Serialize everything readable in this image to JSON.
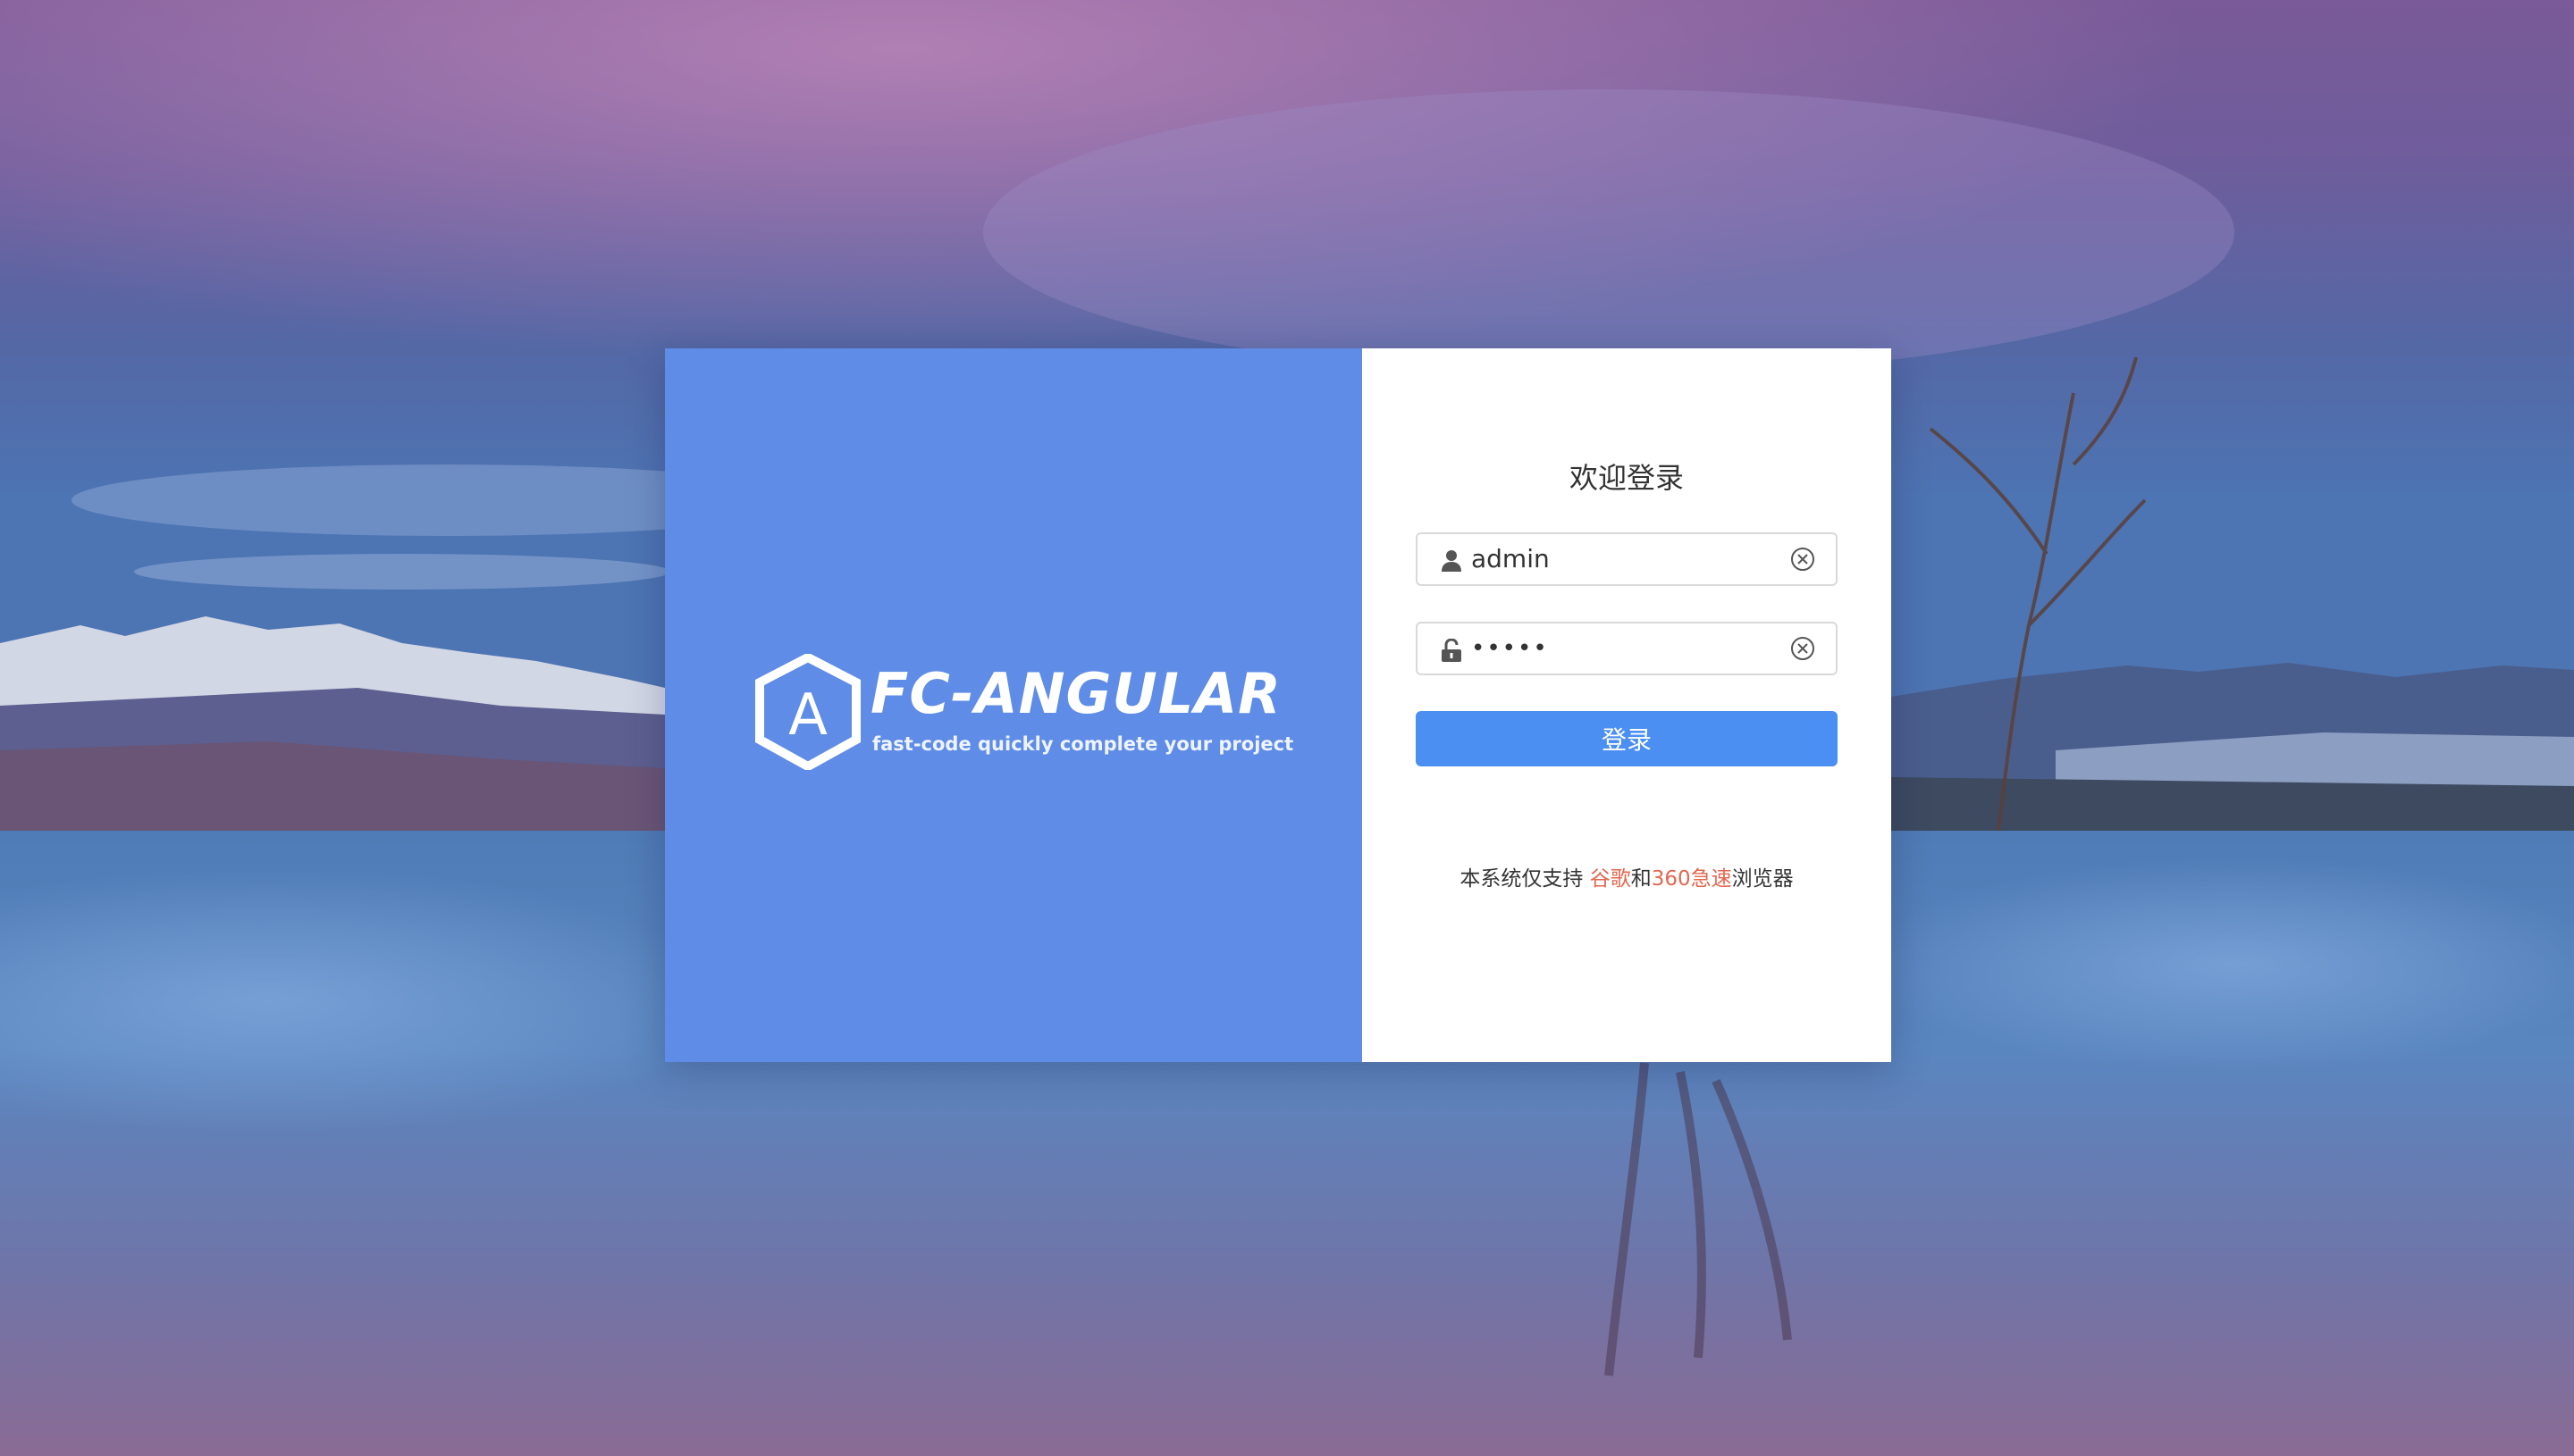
{
  "brand": {
    "logo_letter": "A",
    "name": "FC-ANGULAR",
    "slogan": "fast-code quickly complete your project",
    "panel_color": "#5e8ce6"
  },
  "login": {
    "title": "欢迎登录",
    "username": {
      "value": "admin",
      "icon": "user-icon",
      "clear_icon": "clear-circle-icon"
    },
    "password": {
      "masked_value": "•••••",
      "icon": "unlock-icon",
      "clear_icon": "clear-circle-icon"
    },
    "submit_label": "登录",
    "button_color": "#4b8ff2",
    "note": {
      "prefix": "本系统仅支持 ",
      "browser1": "谷歌",
      "middle": "和",
      "browser2": "360急速",
      "suffix": "浏览器",
      "highlight_color": "#e2674f"
    }
  }
}
